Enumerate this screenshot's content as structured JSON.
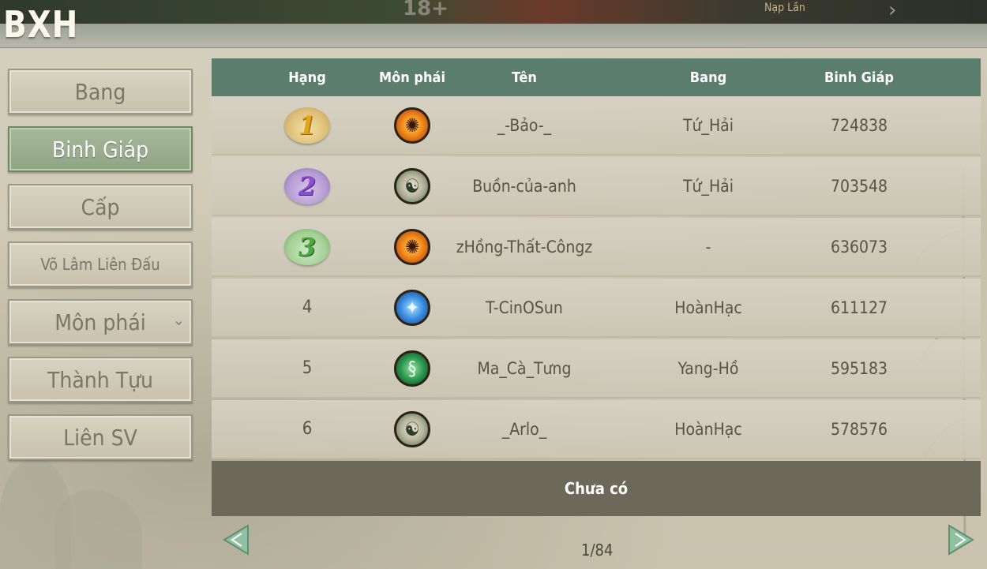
{
  "top_strip": {
    "faint_text": "18+",
    "nap_lan": "Nạp Lần",
    "next_icon": "chevron-right-icon"
  },
  "title": "BXH",
  "sidebar": {
    "items": [
      {
        "label": "Bang",
        "active": false
      },
      {
        "label": "Binh Giáp",
        "active": true
      },
      {
        "label": "Cấp",
        "active": false
      },
      {
        "label": "Võ Lâm Liên Đấu",
        "active": false
      },
      {
        "label": "Môn phái",
        "active": false,
        "has_dropdown": true
      },
      {
        "label": "Thành Tựu",
        "active": false
      },
      {
        "label": "Liên SV",
        "active": false
      }
    ]
  },
  "table": {
    "headers": {
      "rank": "Hạng",
      "sect": "Môn phái",
      "name": "Tên",
      "guild": "Bang",
      "armor": "Binh Giáp"
    },
    "rows": [
      {
        "rank": "1",
        "rank_badge": "gold",
        "sect_icon": "fire-sect-icon",
        "name": "_-Bảo-_",
        "guild": "Tứ_Hải",
        "armor": "724838"
      },
      {
        "rank": "2",
        "rank_badge": "purple",
        "sect_icon": "taiji-sect-icon",
        "name": "Buồn-của-anh",
        "guild": "Tứ_Hải",
        "armor": "703548"
      },
      {
        "rank": "3",
        "rank_badge": "green",
        "sect_icon": "fire-sect-icon",
        "name": "zHồng-Thất-Côngz",
        "guild": "-",
        "armor": "636073"
      },
      {
        "rank": "4",
        "rank_badge": "",
        "sect_icon": "bird-sect-icon",
        "name": "T-CinOSun",
        "guild": "HoànHạc",
        "armor": "611127"
      },
      {
        "rank": "5",
        "rank_badge": "",
        "sect_icon": "snake-sect-icon",
        "name": "Ma_Cà_Tưng",
        "guild": "Yang-Hồ",
        "armor": "595183"
      },
      {
        "rank": "6",
        "rank_badge": "",
        "sect_icon": "taiji-sect-icon",
        "name": "_Arlo_",
        "guild": "HoànHạc",
        "armor": "578576"
      }
    ],
    "self_status": "Chưa có"
  },
  "pager": {
    "text": "1/84",
    "prev_icon": "arrow-left-icon",
    "next_icon": "arrow-right-icon"
  },
  "colors": {
    "header_green": "#5a7d6e",
    "active_tab": "#9aaf8e",
    "footer_bar": "#6c695b"
  }
}
